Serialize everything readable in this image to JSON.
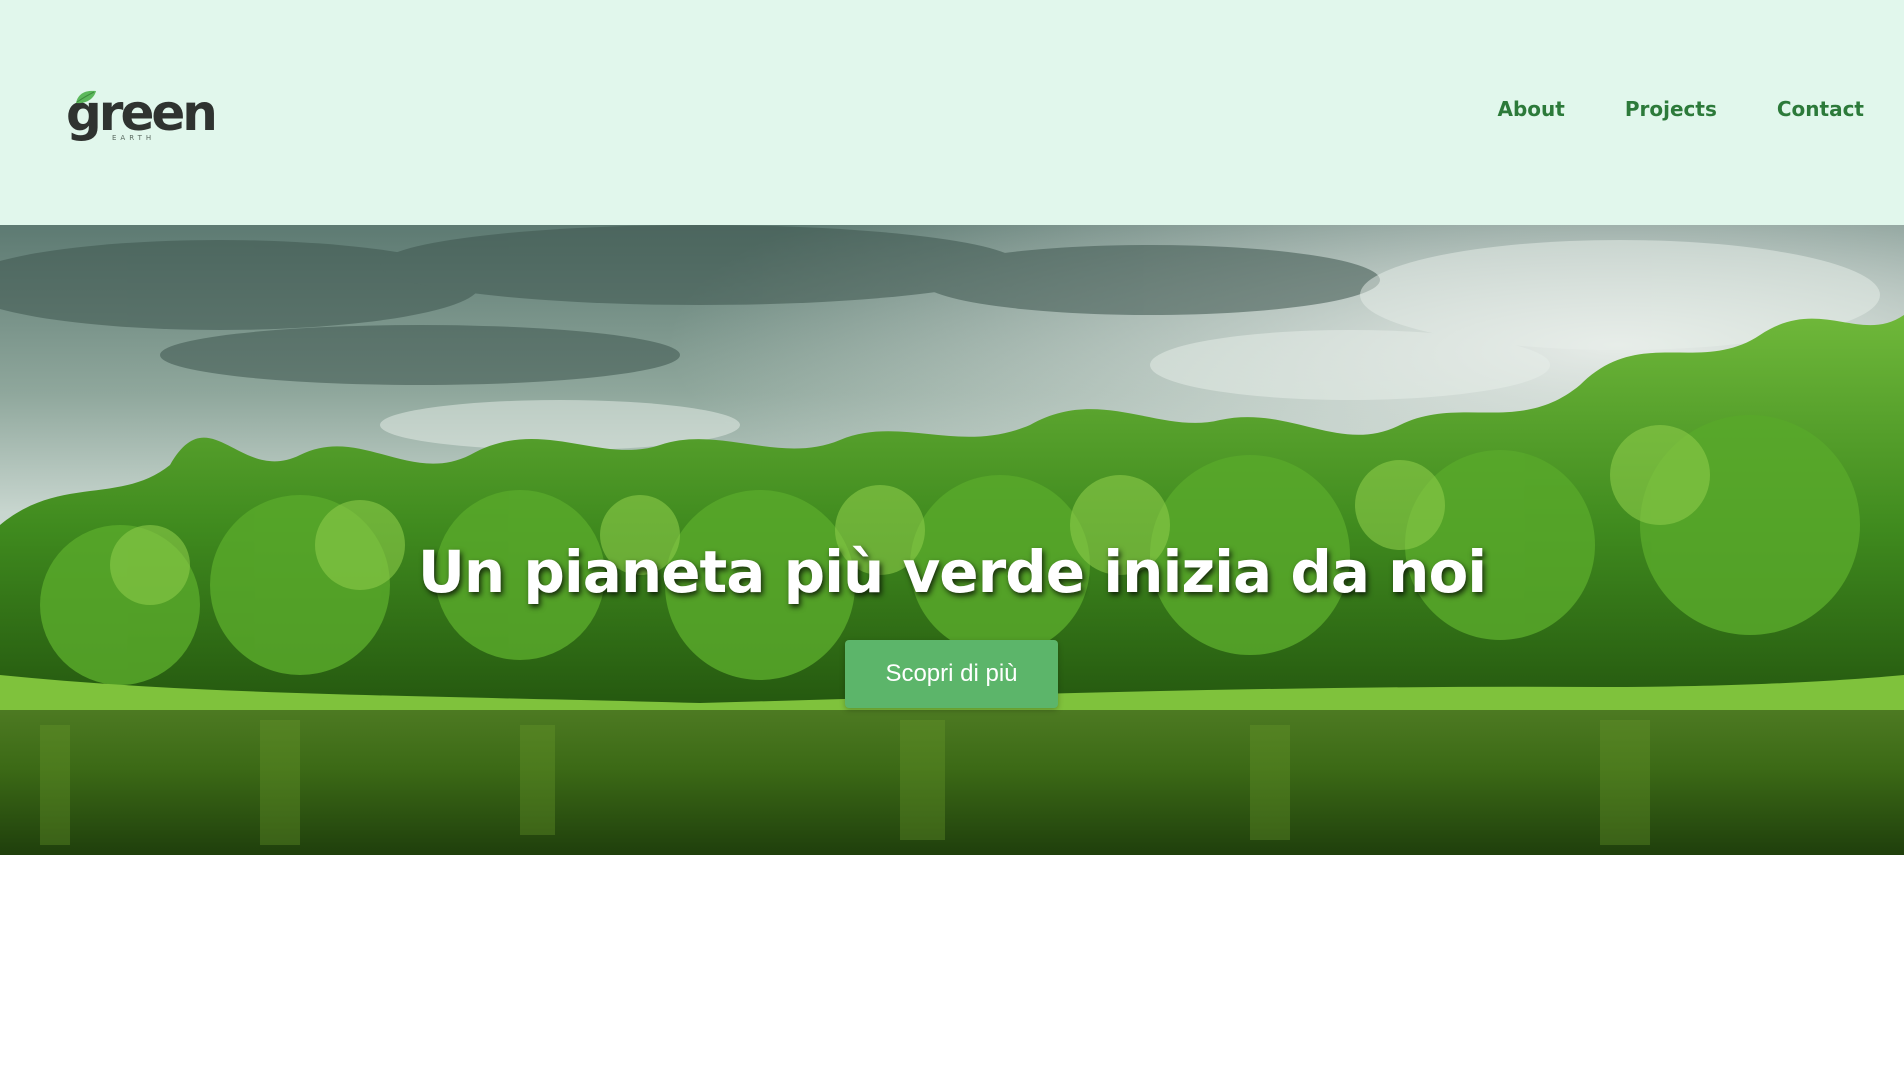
{
  "header": {
    "logo": {
      "word": "green",
      "subtitle": "EARTH"
    },
    "nav": [
      {
        "label": "About"
      },
      {
        "label": "Projects"
      },
      {
        "label": "Contact"
      }
    ]
  },
  "hero": {
    "title": "Un pianeta più verde inizia da noi",
    "button_label": "Scopri di più"
  },
  "colors": {
    "header_bg": "#e1f7ec",
    "nav_link": "#2c7a3a",
    "button_bg": "#5cb56a",
    "logo_leaf": "#5cb85c"
  }
}
